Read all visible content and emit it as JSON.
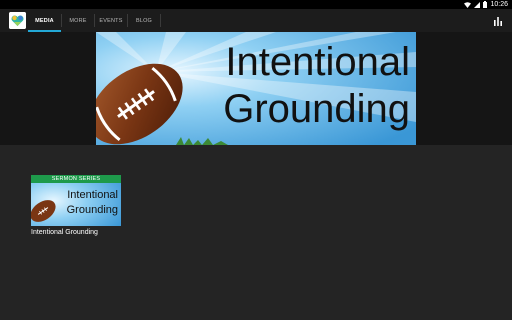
{
  "status_bar": {
    "time": "10:26",
    "icons": [
      "wifi-icon",
      "signal-icon",
      "battery-icon"
    ]
  },
  "app_bar": {
    "logo": "app-logo",
    "tabs": [
      {
        "label": "MEDIA",
        "active": true
      },
      {
        "label": "MORE",
        "active": false
      },
      {
        "label": "EVENTS",
        "active": false
      },
      {
        "label": "BLOG",
        "active": false
      }
    ],
    "action_icon": "bar-chart-icon",
    "accent_color": "#23a8d6"
  },
  "hero": {
    "line1": "Intentional",
    "line2": "Grounding"
  },
  "media_items": [
    {
      "banner": "SERMON SERIES",
      "thumb_line1": "Intentional",
      "thumb_line2": "Grounding",
      "caption": "Intentional Grounding"
    }
  ]
}
